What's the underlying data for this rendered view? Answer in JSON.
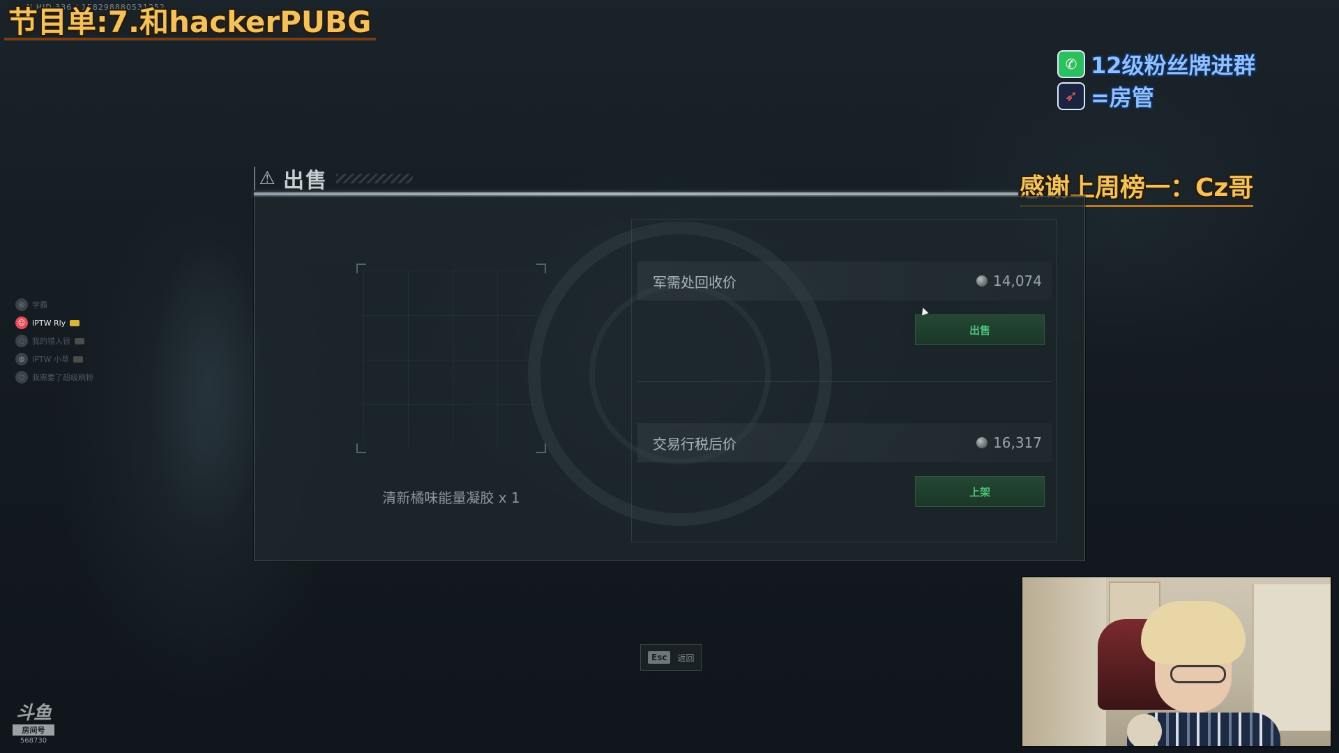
{
  "overlay": {
    "title": "节目单:7.和hackerPUBG",
    "tiny_id": "N HID 336 / 158298880531352",
    "promo_fan_group": "12级粉丝牌进群",
    "promo_admin": "=房管",
    "thanks": "感谢上周榜一：Cz哥"
  },
  "squad": [
    {
      "name": "学霸",
      "active": false
    },
    {
      "name": "IPTW Rly",
      "active": true
    },
    {
      "name": "我的猎人很",
      "active": false
    },
    {
      "name": "IPTW 小草",
      "active": false
    },
    {
      "name": "我需要了超级刷粉",
      "active": false
    }
  ],
  "dialog": {
    "title": "出售",
    "item_name": "清新橘味能量凝胶 x 1",
    "recycle_label": "军需处回收价",
    "recycle_value": "14,074",
    "sell_button": "出售",
    "market_label": "交易行税后价",
    "market_value": "16,317",
    "list_button": "上架"
  },
  "esc_hint": {
    "key": "Esc",
    "label": "返回"
  },
  "douyu": {
    "logo": "斗鱼",
    "room_label": "房间号",
    "room_number": "568730"
  },
  "icons": {
    "wechat": "wechat-icon",
    "rocket": "rocket-icon",
    "coin": "coin-icon",
    "header": "warning-triangle-icon"
  },
  "colors": {
    "overlay_gold": "#f3c25c",
    "promo_blue": "#8fc0ff",
    "action_green": "#4cc27a",
    "accent_squad": "#e94c5b"
  }
}
